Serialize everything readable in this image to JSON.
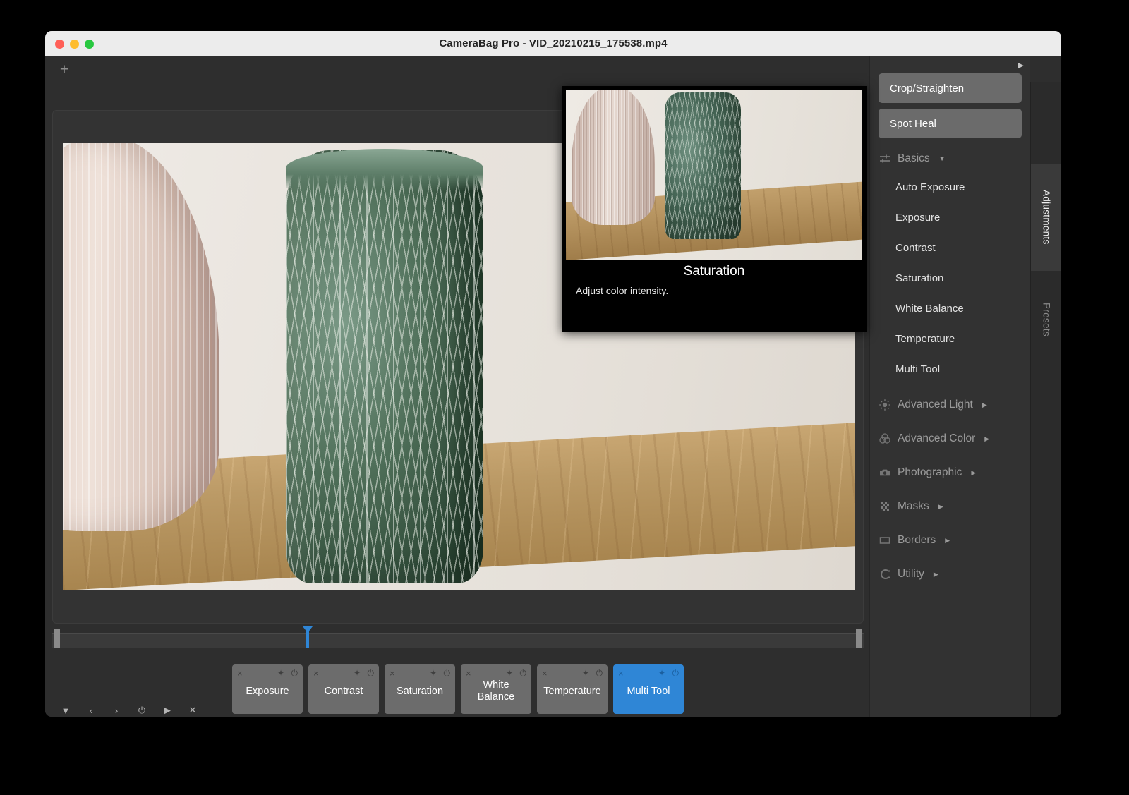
{
  "window": {
    "title": "CameraBag Pro - VID_20210215_175538.mp4",
    "traffic_lights": {
      "close": "close-button",
      "minimize": "minimize-button",
      "zoom": "zoom-button"
    }
  },
  "editor": {
    "add_button_label": "+",
    "collapse_panel_label": "▶"
  },
  "tooltip": {
    "title": "Saturation",
    "description": "Adjust color intensity."
  },
  "timeline": {
    "playhead_position_percent": 31
  },
  "filter_strip": {
    "tiles": [
      {
        "label": "Exposure",
        "selected": false
      },
      {
        "label": "Contrast",
        "selected": false
      },
      {
        "label": "Saturation",
        "selected": false
      },
      {
        "label": "White\nBalance",
        "selected": false
      },
      {
        "label": "Temperature",
        "selected": false
      },
      {
        "label": "Multi Tool",
        "selected": true
      }
    ],
    "tile_icons": {
      "remove": "×",
      "pin": "✦",
      "power": "⏻"
    }
  },
  "transport": {
    "icons": [
      {
        "name": "dropdown-triangle-icon",
        "glyph": "▼"
      },
      {
        "name": "previous-icon",
        "glyph": "‹"
      },
      {
        "name": "next-icon",
        "glyph": "›"
      },
      {
        "name": "power-icon",
        "glyph": "⏻"
      },
      {
        "name": "play-icon",
        "glyph": "▶"
      },
      {
        "name": "close-icon",
        "glyph": "✕"
      }
    ]
  },
  "adjustments_panel": {
    "buttons": [
      {
        "label": "Crop/Straighten"
      },
      {
        "label": "Spot Heal"
      }
    ],
    "sections": [
      {
        "label": "Basics",
        "icon": "sliders-icon",
        "expanded": true,
        "caret": "▼",
        "items": [
          {
            "label": "Auto Exposure"
          },
          {
            "label": "Exposure"
          },
          {
            "label": "Contrast"
          },
          {
            "label": "Saturation"
          },
          {
            "label": "White Balance"
          },
          {
            "label": "Temperature"
          },
          {
            "label": "Multi Tool"
          }
        ]
      },
      {
        "label": "Advanced Light",
        "icon": "sun-icon",
        "expanded": false,
        "caret": "▶",
        "items": []
      },
      {
        "label": "Advanced Color",
        "icon": "color-circles-icon",
        "expanded": false,
        "caret": "▶",
        "items": []
      },
      {
        "label": "Photographic",
        "icon": "camera-icon",
        "expanded": false,
        "caret": "▶",
        "items": []
      },
      {
        "label": "Masks",
        "icon": "checkerboard-icon",
        "expanded": false,
        "caret": "▶",
        "items": []
      },
      {
        "label": "Borders",
        "icon": "rectangle-icon",
        "expanded": false,
        "caret": "▶",
        "items": []
      },
      {
        "label": "Utility",
        "icon": "magnet-icon",
        "expanded": false,
        "caret": "▶",
        "items": []
      }
    ]
  },
  "side_tabs": [
    {
      "label": "Adjustments",
      "active": true
    },
    {
      "label": "Presets",
      "active": false
    }
  ],
  "colors": {
    "accent": "#2f86d6",
    "panel_bg": "#323232",
    "window_bg": "#2e2e2e",
    "titlebar_bg": "#ececec",
    "button_bg": "#6b6b6b",
    "tile_bg": "#6c6c6c",
    "tooltip_bg": "#000000"
  }
}
